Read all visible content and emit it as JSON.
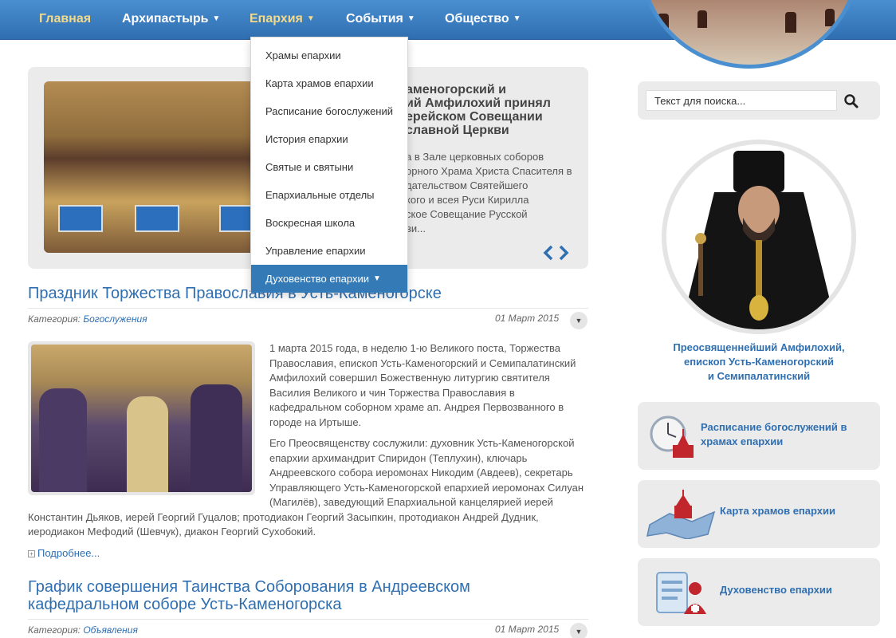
{
  "nav": {
    "items": [
      {
        "label": "Главная"
      },
      {
        "label": "Архипастырь"
      },
      {
        "label": "Епархия"
      },
      {
        "label": "События"
      },
      {
        "label": "Общество"
      }
    ]
  },
  "dropdown": {
    "items": [
      {
        "label": "Храмы епархии"
      },
      {
        "label": "Карта храмов епархии"
      },
      {
        "label": "Расписание богослужений"
      },
      {
        "label": "История епархии"
      },
      {
        "label": "Святые и святыни"
      },
      {
        "label": "Епархиальные отделы"
      },
      {
        "label": "Воскресная школа"
      },
      {
        "label": "Управление епархии"
      },
      {
        "label": "Духовенство епархии"
      }
    ]
  },
  "slider": {
    "title": "аменогорский и\nий Амфилохий принял\nерейском Совещании\nславной Церкви",
    "text": "а в Зале церковных соборов\nорного Храма Христа Спасителя в\nдательством Святейшего\nкого и всея Руси Кирилла\nское Совещание Русской\nви...",
    "arrows": "‹›"
  },
  "article1": {
    "title": "Праздник Торжества Православия в Усть-Каменогорске",
    "category_label": "Категория:",
    "category": "Богослужения",
    "date": "01 Март 2015",
    "p1": "1 марта 2015 года, в неделю 1-ю Великого поста, Торжества Православия, епископ Усть-Каменогорский и Семипалатинский Амфилохий совершил Божественную литургию святителя Василия Великого и чин Торжества Православия в кафедральном соборном храме ап. Андрея Первозванного в городе на Иртыше.",
    "p2": "Его Преосвященству сослужили: духовник Усть-Каменогорской епархии архимандрит Спиридон (Теплухин), ключарь Андреевского собора иеромонах Никодим (Авдеев), секретарь Управляющего Усть-Каменогорской епархией иеромонах Силуан (Магилёв), заведующий Епархиальной канцелярией иерей Константин Дьяков, иерей Георгий Гуцалов; протодиакон Георгий Засыпкин, протодиакон Андрей Дудник, иеродиакон Мефодий (Шевчук), диакон Георгий Сухобокий.",
    "more": "Подробнее..."
  },
  "article2": {
    "title": "График совершения Таинства Соборования в Андреевском кафедральном соборе Усть-Каменогорска",
    "category_label": "Категория:",
    "category": "Объявления",
    "date": "01 Март 2015"
  },
  "search": {
    "placeholder": "Текст для поиска..."
  },
  "bishop": {
    "caption_line1": "Преосвященнейший Амфилохий,",
    "caption_line2": "епископ Усть-Каменогорский",
    "caption_line3": "и Семипалатинский"
  },
  "side": {
    "schedule": "Расписание богослужений в храмах епархии",
    "map": "Карта храмов епархии",
    "clergy": "Духовенство епархии"
  },
  "colors": {
    "accent": "#2f6fb1",
    "nav_active": "#f3d98a",
    "dropdown_active": "#337ab7"
  }
}
